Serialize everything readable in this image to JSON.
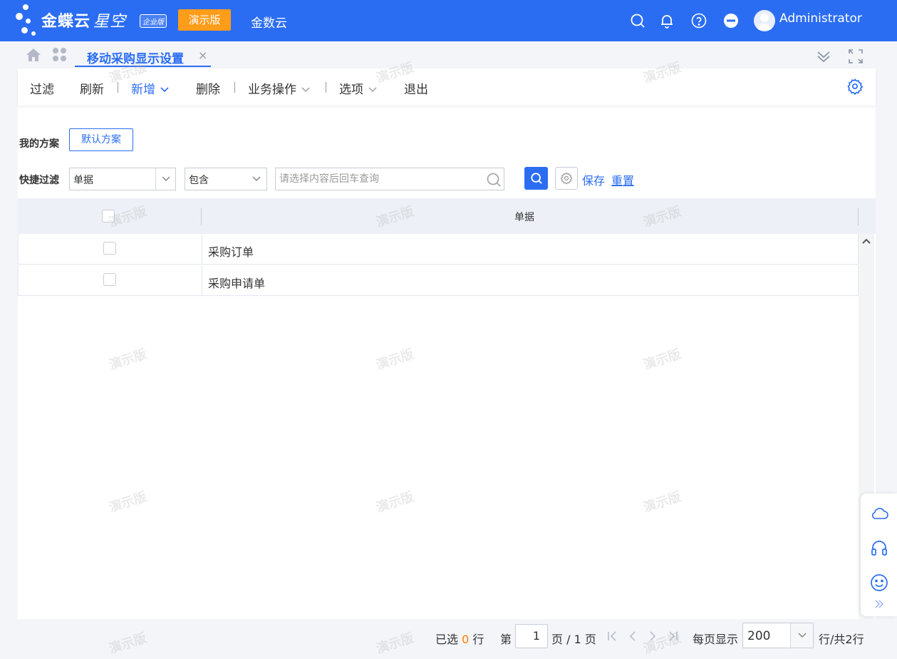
{
  "header": {
    "brand": "金蝶云",
    "brand_sub": "星空",
    "edition": "企业版",
    "demo_badge": "演示版",
    "cloud_name": "金数云",
    "user": "Administrator",
    "icons": [
      "search-icon",
      "bell-icon",
      "help-icon",
      "minus-circle-icon"
    ],
    "brand_color": "#2b6df2",
    "badge_color": "#ff9c1a"
  },
  "tabs": {
    "active_label": "移动采购显示设置",
    "close_glyph": "×"
  },
  "toolbar": {
    "filter": "过滤",
    "refresh": "刷新",
    "add": "新增",
    "delete": "删除",
    "business": "业务操作",
    "options": "选项",
    "exit": "退出"
  },
  "scheme": {
    "label": "我的方案",
    "default_button": "默认方案"
  },
  "quick_filter": {
    "label": "快捷过滤",
    "field_value": "单据",
    "operator_value": "包含",
    "search_placeholder": "请选择内容后回车查询",
    "save": "保存",
    "reset": "重置"
  },
  "grid": {
    "column_header": "单据",
    "rows": [
      {
        "label": "采购订单",
        "checked": false
      },
      {
        "label": "采购申请单",
        "checked": false
      }
    ]
  },
  "pager": {
    "selected_prefix": "已选",
    "selected_count": "0",
    "selected_suffix": "行",
    "page_prefix": "第",
    "page_value": "1",
    "page_suffix": "页 / 1 页",
    "per_page_label": "每页显示",
    "per_page_value": "200",
    "total_text": "行/共2行"
  },
  "watermark": "演示版"
}
